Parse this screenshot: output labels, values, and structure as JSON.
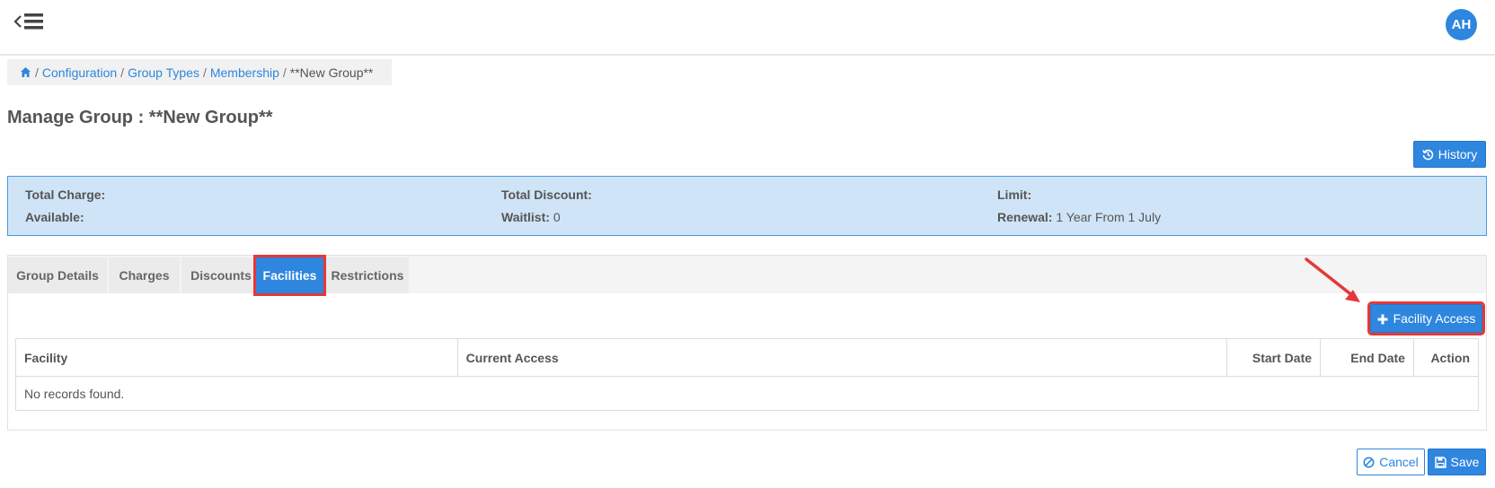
{
  "header": {
    "avatar_initials": "AH"
  },
  "breadcrumb": {
    "items": [
      "Configuration",
      "Group Types",
      "Membership"
    ],
    "current": "**New Group**",
    "separator": "/"
  },
  "page": {
    "title": "Manage Group : **New Group**"
  },
  "history_button": {
    "label": "History"
  },
  "summary": {
    "total_charge_label": "Total Charge:",
    "available_label": "Available:",
    "total_discount_label": "Total Discount:",
    "waitlist_label": "Waitlist:",
    "waitlist_value": "0",
    "limit_label": "Limit:",
    "renewal_label": "Renewal:",
    "renewal_value": "1 Year From 1 July"
  },
  "tabs": [
    {
      "label": "Group Details",
      "active": false
    },
    {
      "label": "Charges",
      "active": false
    },
    {
      "label": "Discounts",
      "active": false
    },
    {
      "label": "Facilities",
      "active": true
    },
    {
      "label": "Restrictions",
      "active": false
    }
  ],
  "facility_access_button": {
    "label": "Facility Access"
  },
  "table": {
    "columns": [
      "Facility",
      "Current Access",
      "Start Date",
      "End Date",
      "Action"
    ],
    "empty_message": "No records found."
  },
  "footer": {
    "cancel_label": "Cancel",
    "save_label": "Save"
  },
  "colors": {
    "primary": "#2e86de",
    "highlight": "#e53838",
    "summary_bg": "#cfe4f7"
  }
}
